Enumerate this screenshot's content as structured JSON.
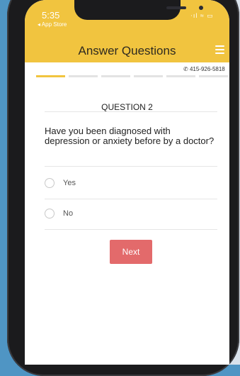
{
  "status_bar": {
    "time": "5:35",
    "back_label": "◂ App Store",
    "icons_text": "⋅ıl ≈ ▭"
  },
  "header": {
    "title": "Answer Questions",
    "color": "#f1c43f"
  },
  "contact": {
    "phone_icon": "phone-icon",
    "phone": "415-926-5818"
  },
  "progress": {
    "total_steps": 6,
    "current_step": 1,
    "active_color": "#f1c43f"
  },
  "question": {
    "label": "QUESTION 2",
    "text": "Have you been diagnosed with depression or anxiety before by a doctor?"
  },
  "options": [
    {
      "label": "Yes"
    },
    {
      "label": "No"
    }
  ],
  "actions": {
    "next_label": "Next",
    "next_color": "#e36a6b"
  }
}
